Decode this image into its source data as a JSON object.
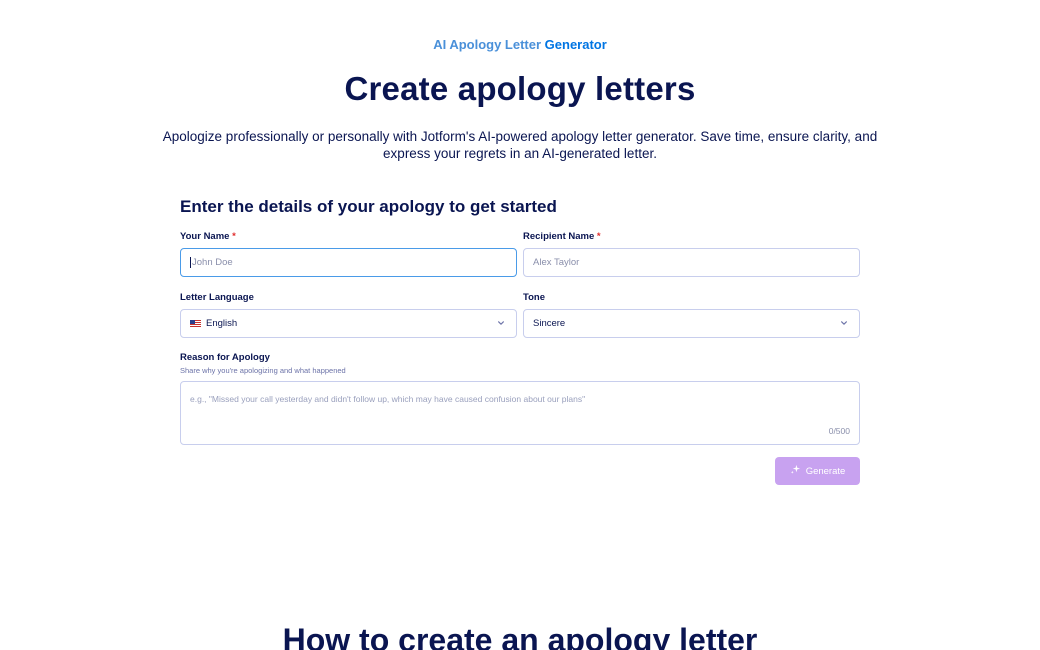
{
  "hero": {
    "eyebrow_part1": "AI Apology Letter",
    "eyebrow_part2": "Generator",
    "title": "Create apology letters",
    "description": "Apologize professionally or personally with Jotform's AI-powered apology letter generator. Save time, ensure clarity, and express your regrets in an AI-generated letter."
  },
  "form": {
    "heading": "Enter the details of your apology to get started",
    "your_name": {
      "label": "Your Name",
      "required_mark": "*",
      "placeholder": "John Doe"
    },
    "recipient_name": {
      "label": "Recipient Name",
      "required_mark": "*",
      "placeholder": "Alex Taylor"
    },
    "letter_language": {
      "label": "Letter Language",
      "value": "English",
      "flag_icon": "us-flag-icon"
    },
    "tone": {
      "label": "Tone",
      "value": "Sincere"
    },
    "reason": {
      "label": "Reason for Apology",
      "sublabel": "Share why you're apologizing and what happened",
      "placeholder": "e.g., \"Missed your call yesterday and didn't follow up, which may have caused confusion about our plans\"",
      "counter": "0/500"
    },
    "generate_label": "Generate"
  },
  "next_section": {
    "title": "How to create an apology letter"
  },
  "colors": {
    "text_dark": "#0a1551",
    "eyebrow_blue": "#4a90d9",
    "eyebrow_brand": "#0075e3",
    "focus_border": "#4a9be8",
    "required": "#e02e2e",
    "generate_disabled": "#c8a2f0"
  }
}
